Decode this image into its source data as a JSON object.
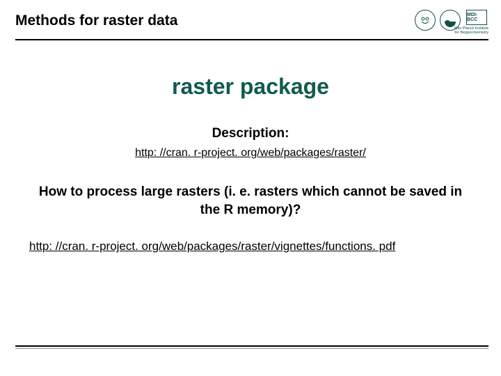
{
  "header": {
    "title": "Methods for raster data",
    "logo3_text": "MDI-BCC",
    "caption_line1": "Max Planck Institute",
    "caption_line2": "for Biogeochemistry"
  },
  "main": {
    "package_title": "raster package",
    "description_label": "Description:",
    "description_link": "http: //cran. r-project. org/web/packages/raster/",
    "question": "How to process large rasters (i. e. rasters which cannot be saved in the R memory)?",
    "vignette_link": "http: //cran. r-project. org/web/packages/raster/vignettes/functions. pdf"
  }
}
